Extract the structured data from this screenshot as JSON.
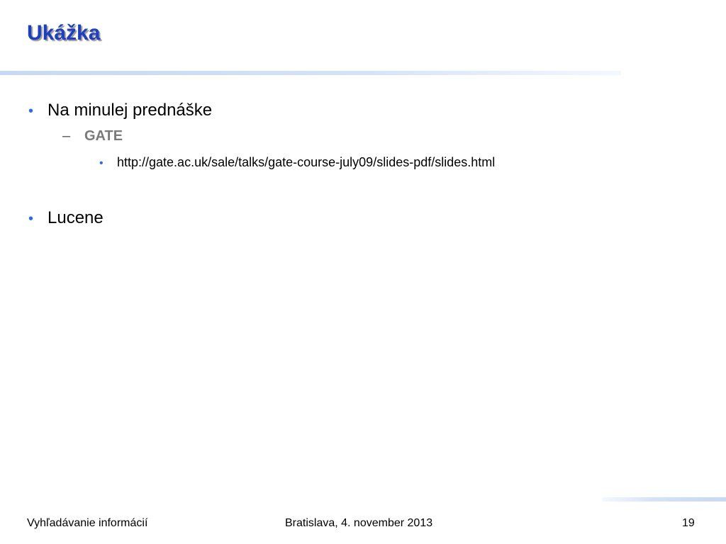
{
  "slide": {
    "title": "Ukážka",
    "bullets": {
      "item1": {
        "marker": "•",
        "text": "Na minulej prednáške"
      },
      "item1_sub": {
        "marker": "–",
        "text": "GATE"
      },
      "item1_sub_sub": {
        "marker": "•",
        "text": "http://gate.ac.uk/sale/talks/gate-course-july09/slides-pdf/slides.html"
      },
      "item2": {
        "marker": "•",
        "text": "Lucene"
      }
    }
  },
  "footer": {
    "left": "Vyhľadávanie informácií",
    "center": "Bratislava, 4. november 2013",
    "page_number": "19"
  },
  "colors": {
    "title": "#1f3fbf",
    "bullet_accent": "#2f6ed8",
    "sub_bullet_text": "#7a7a7a",
    "rule": "#c7d8f2"
  }
}
